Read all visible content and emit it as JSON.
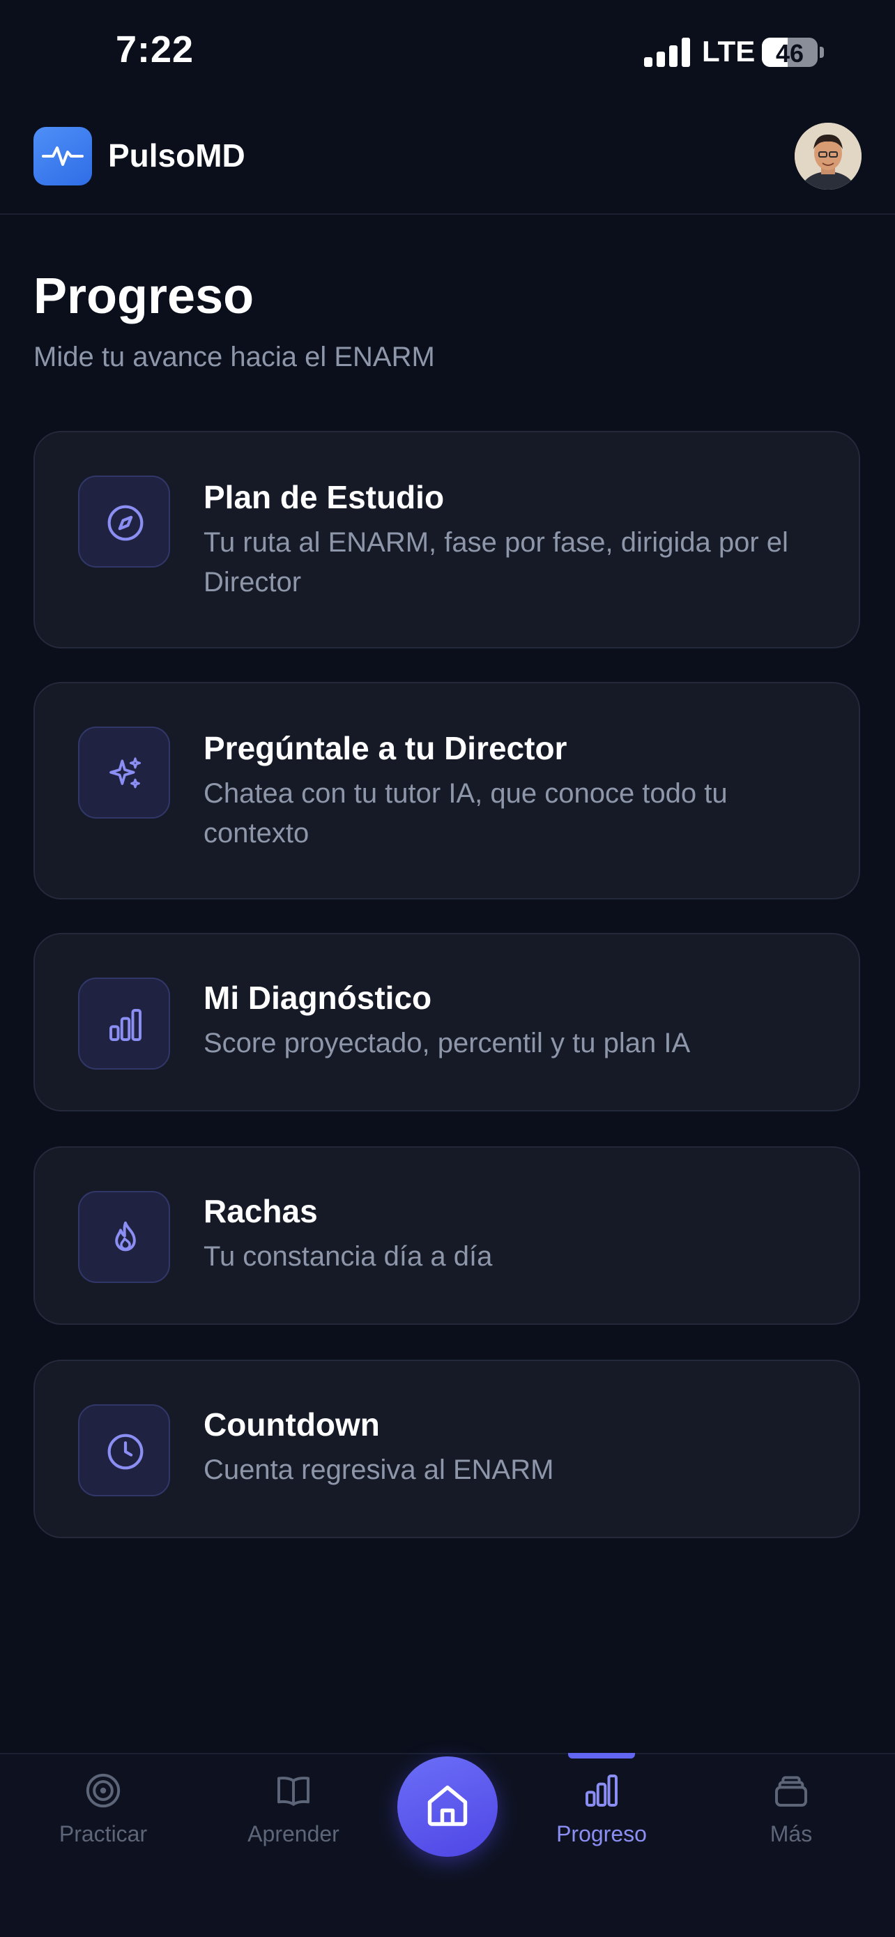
{
  "status_bar": {
    "time": "7:22",
    "network": "LTE",
    "battery_level": 46,
    "battery_text": "46"
  },
  "header": {
    "brand": "PulsoMD",
    "logo_icon": "heartbeat-icon",
    "avatar": "user-avatar"
  },
  "page": {
    "title": "Progreso",
    "subtitle": "Mide tu avance hacia el ENARM"
  },
  "cards": [
    {
      "title": "Plan de Estudio",
      "description": "Tu ruta al ENARM, fase por fase, dirigida por el Director",
      "icon": "compass-icon"
    },
    {
      "title": "Pregúntale a tu Director",
      "description": "Chatea con tu tutor IA, que conoce todo tu contexto",
      "icon": "sparkles-icon"
    },
    {
      "title": "Mi Diagnóstico",
      "description": "Score proyectado, percentil y tu plan IA",
      "icon": "bar-chart-icon"
    },
    {
      "title": "Rachas",
      "description": "Tu constancia día a día",
      "icon": "flame-icon"
    },
    {
      "title": "Countdown",
      "description": "Cuenta regresiva al ENARM",
      "icon": "clock-icon"
    }
  ],
  "bottom_nav": {
    "active": "Progreso",
    "items": [
      {
        "label": "Practicar",
        "icon": "target-icon"
      },
      {
        "label": "Aprender",
        "icon": "book-icon"
      },
      {
        "label": "",
        "icon": "home-icon"
      },
      {
        "label": "Progreso",
        "icon": "bar-chart-icon"
      },
      {
        "label": "Más",
        "icon": "stack-icon"
      }
    ]
  },
  "colors": {
    "background": "#0b0f1c",
    "card": "#161a27",
    "accent": "#6366f1",
    "accent_light": "#8b8ef2",
    "muted_text": "#8e97aa"
  }
}
